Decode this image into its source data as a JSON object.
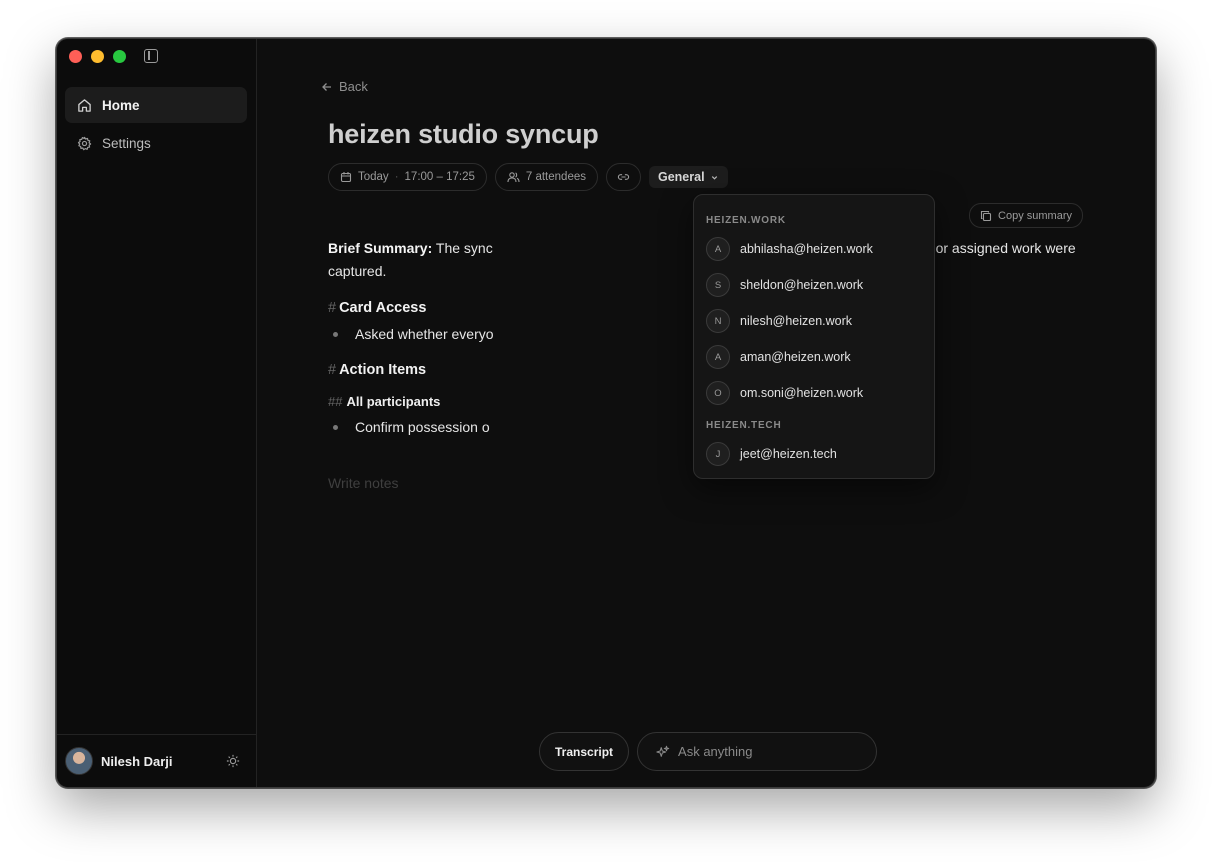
{
  "sidebar": {
    "items": [
      {
        "label": "Home",
        "icon": "home-icon",
        "active": true
      },
      {
        "label": "Settings",
        "icon": "gear-icon",
        "active": false
      }
    ],
    "user": {
      "name": "Nilesh Darji"
    }
  },
  "main": {
    "back_label": "Back",
    "title": "heizen studio syncup",
    "meta": {
      "date": "Today",
      "separator": "·",
      "time": "17:00 – 17:25",
      "attendees": "7 attendees",
      "folder": "General"
    },
    "copy_summary_label": "Copy summary",
    "summary": {
      "label": "Brief Summary:",
      "text_start": " The sync",
      "text_end": "; no project updates, decisions, or assigned work were",
      "text_line2": "captured."
    },
    "sections": [
      {
        "hash": "#",
        "title": "Card Access",
        "bullets": [
          "Asked whether everyo"
        ]
      },
      {
        "hash": "#",
        "title": "Action Items"
      }
    ],
    "subsection": {
      "hash": "##",
      "title": "All participants",
      "bullets": [
        "Confirm possession o"
      ]
    },
    "notes_placeholder": "Write notes"
  },
  "attendee_dropdown": {
    "groups": [
      {
        "label": "HEIZEN.WORK",
        "attendees": [
          {
            "initial": "A",
            "email": "abhilasha@heizen.work"
          },
          {
            "initial": "S",
            "email": "sheldon@heizen.work"
          },
          {
            "initial": "N",
            "email": "nilesh@heizen.work"
          },
          {
            "initial": "A",
            "email": "aman@heizen.work"
          },
          {
            "initial": "O",
            "email": "om.soni@heizen.work"
          }
        ]
      },
      {
        "label": "HEIZEN.TECH",
        "attendees": [
          {
            "initial": "J",
            "email": "jeet@heizen.tech"
          }
        ]
      }
    ]
  },
  "bottom": {
    "transcript_label": "Transcript",
    "ask_placeholder": "Ask anything"
  },
  "colors": {
    "background": "#0e0e0e",
    "sidebar": "#0c0c0c",
    "traffic_red": "#fe5f57",
    "traffic_yellow": "#febc2e",
    "traffic_green": "#28c840"
  }
}
